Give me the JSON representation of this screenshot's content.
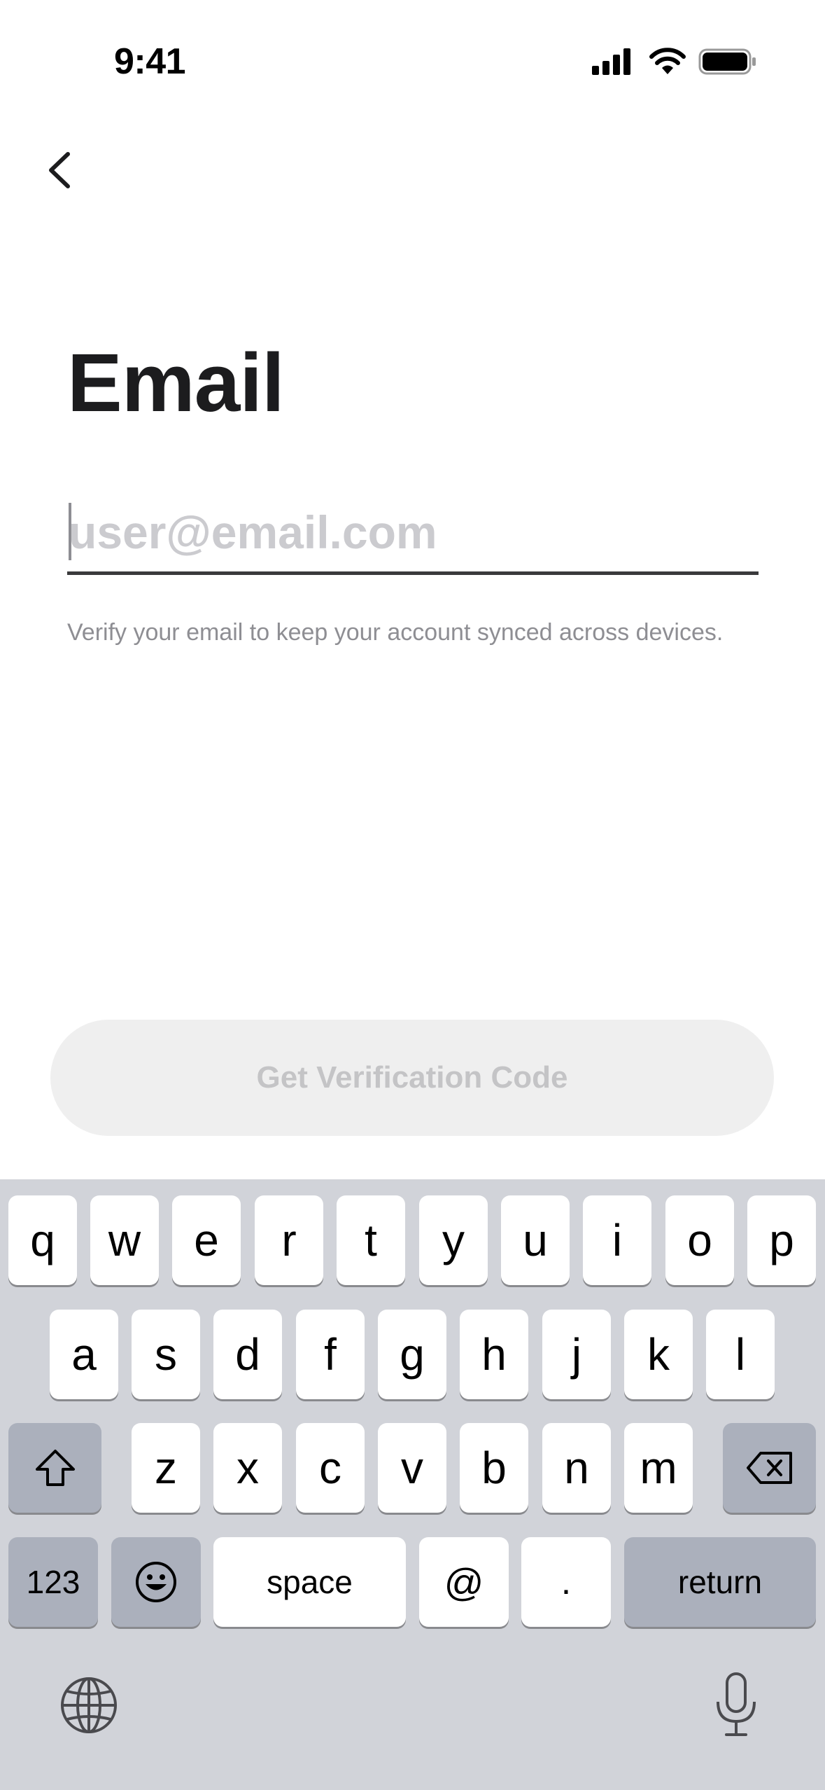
{
  "status_bar": {
    "time": "9:41"
  },
  "navigation": {
    "back_icon": "chevron-left-icon"
  },
  "page": {
    "title": "Email",
    "email_field": {
      "value": "",
      "placeholder": "user@email.com"
    },
    "helper_text": "Verify your email to keep your account synced across devices.",
    "cta_label": "Get Verification Code"
  },
  "keyboard": {
    "row1": [
      "q",
      "w",
      "e",
      "r",
      "t",
      "y",
      "u",
      "i",
      "o",
      "p"
    ],
    "row2": [
      "a",
      "s",
      "d",
      "f",
      "g",
      "h",
      "j",
      "k",
      "l"
    ],
    "row3": [
      "z",
      "x",
      "c",
      "v",
      "b",
      "n",
      "m"
    ],
    "numbers_label": "123",
    "space_label": "space",
    "at_label": "@",
    "dot_label": ".",
    "return_label": "return",
    "icons": [
      "shift-icon",
      "backspace-icon",
      "emoji-icon",
      "globe-icon",
      "microphone-icon"
    ]
  },
  "colors": {
    "title": "#1c1c1e",
    "placeholder": "#cbcbcf",
    "helper": "#8e8e93",
    "cta_background": "#efefef",
    "cta_text": "#c4c4c6",
    "keyboard_background": "#d1d3d9"
  }
}
